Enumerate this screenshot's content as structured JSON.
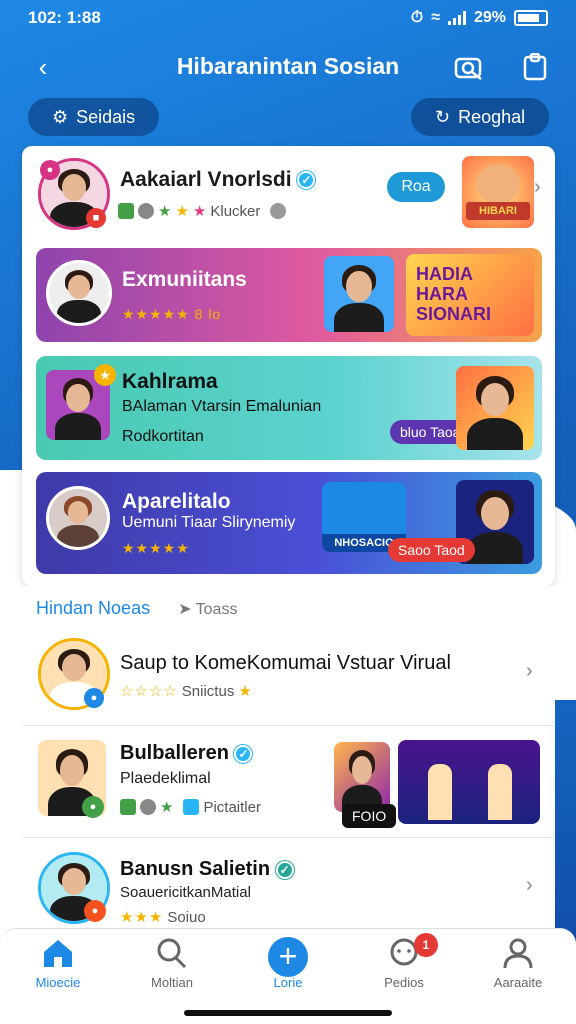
{
  "status": {
    "time": "102: 1:88",
    "battery": "29%"
  },
  "header": {
    "title": "Hibaranintan Sosian"
  },
  "filters": {
    "left_label": "Seidais",
    "right_label": "Reoghal"
  },
  "featured": {
    "name": "Aakaiarl Vnorlsdi",
    "meta": "Klucker",
    "follow_label": "Roa",
    "sticker_text": "HIBARI"
  },
  "banners": [
    {
      "name": "Exmuniitans",
      "meta": "★★★★★ 8 lo",
      "art_text": "HADIA HARA SIONARI",
      "colors": [
        "#8e44ad",
        "#e05aa0",
        "#f7a34a"
      ]
    },
    {
      "name": "Kahlrama",
      "sub": "BAlaman Vtarsin Emalunian",
      "meta": "Rodkortitan",
      "tag": "bluo Taoa",
      "colors": [
        "#48c9b0",
        "#5dd3d0",
        "#a6e3e9"
      ]
    },
    {
      "name": "Aparelitalo",
      "sub": "Uemuni Tiaar Slirynemiy",
      "meta": "★★★★★",
      "tag": "Saoo Taod",
      "thumb_text": "NHOSACIO",
      "colors": [
        "#3f3aa8",
        "#4a4fd6",
        "#3b9ce0"
      ]
    }
  ],
  "list": {
    "heading": "Hindan Noeas",
    "heading_link": "Toass",
    "items": [
      {
        "name": "Saup to KomeKomumai Vstuar Virual",
        "meta": "Sniictus"
      },
      {
        "name": "Bulballeren",
        "sub": "Plaedeklimal",
        "meta": "Pictaitler",
        "thumb_text": "FOIO"
      },
      {
        "name": "Banusn Salietin",
        "sub": "SoauericitkanMatial",
        "meta": "Soiuo"
      }
    ]
  },
  "nav": {
    "items": [
      {
        "label": "Mioecie",
        "icon": "home-icon"
      },
      {
        "label": "Moltian",
        "icon": "search-icon"
      },
      {
        "label": "Lorie",
        "icon": "add-icon"
      },
      {
        "label": "Pedios",
        "icon": "chat-icon",
        "badge": "1"
      },
      {
        "label": "Aaraaite",
        "icon": "profile-icon"
      }
    ]
  }
}
